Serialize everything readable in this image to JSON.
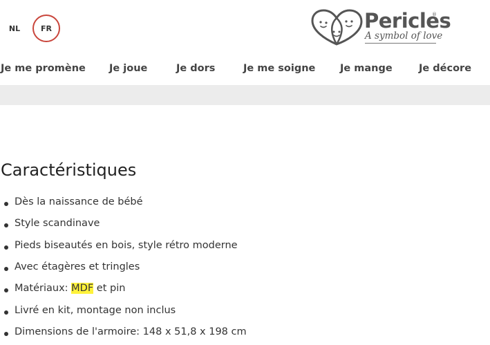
{
  "languages": [
    {
      "code": "NL",
      "active": false
    },
    {
      "code": "FR",
      "active": true
    }
  ],
  "brand": {
    "name": "Pericles",
    "registered": "®",
    "tagline": "A symbol of love",
    "accent_color": "#c9453b"
  },
  "nav": {
    "items": [
      {
        "label": "Je me promène"
      },
      {
        "label": "Je joue"
      },
      {
        "label": "Je dors"
      },
      {
        "label": "Je me soigne"
      },
      {
        "label": "Je mange"
      },
      {
        "label": "Je décore"
      }
    ]
  },
  "features": {
    "title": "Caractéristiques",
    "items": [
      {
        "text": "Dès la naissance de bébé"
      },
      {
        "text": "Style scandinave"
      },
      {
        "text": "Pieds biseautés en bois, style rétro moderne"
      },
      {
        "text": "Avec étagères et tringles"
      },
      {
        "prefix": "Matériaux: ",
        "highlight": "MDF",
        "suffix": " et pin",
        "highlight_color": "#fff23b"
      },
      {
        "text": "Livré en kit, montage non inclus"
      },
      {
        "text": "Dimensions de l'armoire: 148 x 51,8 x 198 cm"
      }
    ]
  }
}
